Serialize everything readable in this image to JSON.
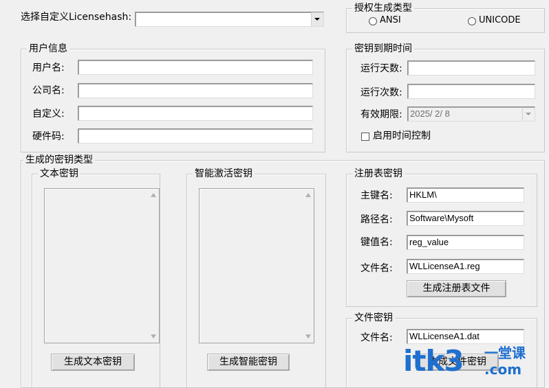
{
  "hash_select": {
    "label": "选择自定义Licensehash:",
    "value": ""
  },
  "license_type": {
    "title": "授权生成类型",
    "options": [
      "ANSI",
      "UNICODE"
    ]
  },
  "user_info": {
    "title": "用户信息",
    "username_label": "用户名:",
    "company_label": "公司名:",
    "custom_label": "自定义:",
    "hardware_label": "硬件码:",
    "username": "",
    "company": "",
    "custom": "",
    "hardware": ""
  },
  "expiry": {
    "title": "密钥到期时间",
    "days_label": "运行天数:",
    "runs_label": "运行次数:",
    "date_label": "有效期限:",
    "date_value": "2025/ 2/ 8",
    "enable_label": "启用时间控制"
  },
  "key_types": {
    "title": "生成的密钥类型",
    "text_key": {
      "title": "文本密钥",
      "button": "生成文本密钥"
    },
    "smart_key": {
      "title": "智能激活密钥",
      "button": "生成智能密钥"
    }
  },
  "registry": {
    "title": "注册表密钥",
    "root_label": "主键名:",
    "root_value": "HKLM\\",
    "path_label": "路径名:",
    "path_value": "Software\\Mysoft",
    "value_label": "键值名:",
    "value_value": "reg_value",
    "file_label": "文件名:",
    "file_value": "WLLicenseA1.reg",
    "button": "生成注册表文件"
  },
  "file_key": {
    "title": "文件密钥",
    "file_label": "文件名:",
    "file_value": "WLLicenseA1.dat",
    "button": "生成文件密钥"
  },
  "watermark": {
    "brand": "itk3",
    "tagline": "一堂课",
    "domain": ".com"
  }
}
